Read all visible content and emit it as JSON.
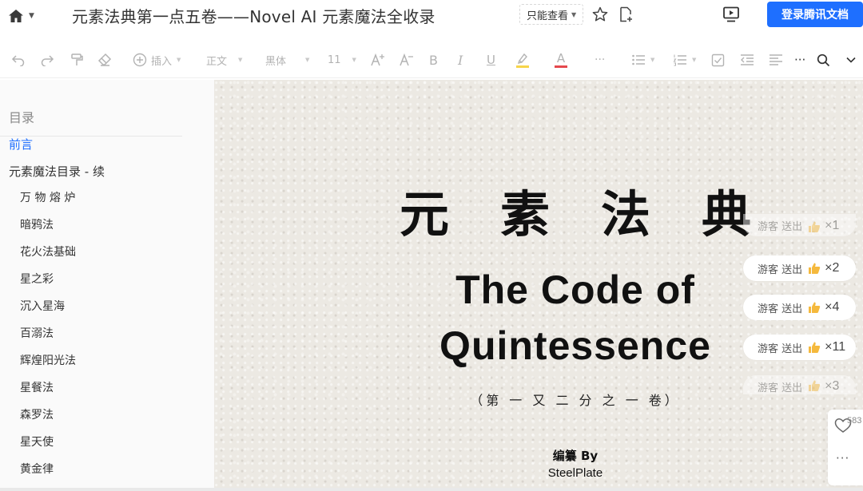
{
  "header": {
    "doc_title": "元素法典第一点五卷——Novel AI 元素魔法全收录",
    "mode_label": "只能查看",
    "login_label": "登录腾讯文档"
  },
  "toolbar": {
    "insert_label": "插入",
    "paragraph_style": "正文",
    "font_name": "黑体",
    "font_size": "11",
    "bold_glyph": "B",
    "italic_glyph": "I",
    "underline_glyph": "U",
    "font_color_glyph": "A",
    "more_glyph": "···",
    "highlight_color": "#f7d54a",
    "font_color_bar": "#e5484d"
  },
  "toc": {
    "heading": "目录",
    "items": [
      {
        "label": "前言",
        "level": 1,
        "active": true
      },
      {
        "label": "元素魔法目录 - 续",
        "level": 1,
        "active": false
      },
      {
        "label": "万 物 熔 炉",
        "level": 2
      },
      {
        "label": "暗鸦法",
        "level": 2
      },
      {
        "label": "花火法基础",
        "level": 2
      },
      {
        "label": "星之彩",
        "level": 2
      },
      {
        "label": "沉入星海",
        "level": 2
      },
      {
        "label": "百溺法",
        "level": 2
      },
      {
        "label": "辉煌阳光法",
        "level": 2
      },
      {
        "label": "星餐法",
        "level": 2
      },
      {
        "label": "森罗法",
        "level": 2
      },
      {
        "label": "星天使",
        "level": 2
      },
      {
        "label": "黄金律",
        "level": 2
      }
    ]
  },
  "cover": {
    "cn_chars": [
      "元",
      "素",
      "法",
      "典"
    ],
    "en_line1": "The Code of",
    "en_line2": "Quintessence",
    "volume": "（第 一 又 二 分 之 一 卷）",
    "by_label": "编纂 By",
    "author": "SteelPlate"
  },
  "gifts": [
    {
      "sender": "游客",
      "action": "送出",
      "count": "×2"
    },
    {
      "sender": "游客",
      "action": "送出",
      "count": "×4"
    },
    {
      "sender": "游客",
      "action": "送出",
      "count": "×11"
    },
    {
      "sender": "游客",
      "action": "送出",
      "count": "×3"
    },
    {
      "sender": "游客",
      "action": "送出",
      "count": "×1"
    }
  ],
  "side": {
    "like_count": "583",
    "more_glyph": "···"
  }
}
